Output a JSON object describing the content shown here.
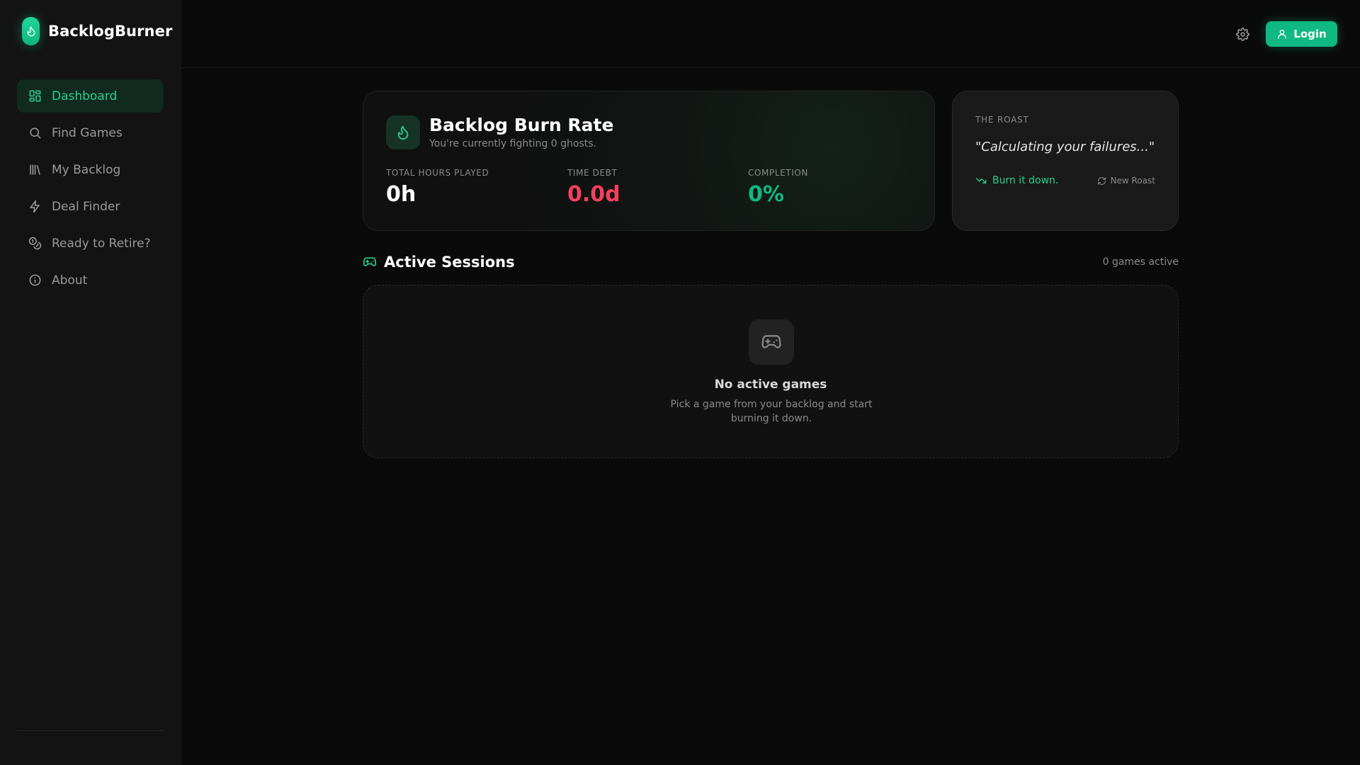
{
  "brand": {
    "name": "BacklogBurner",
    "accent": "#10b981"
  },
  "sidebar": {
    "items": [
      {
        "label": "Dashboard",
        "icon": "dashboard-grid-icon",
        "active": true
      },
      {
        "label": "Find Games",
        "icon": "search-icon"
      },
      {
        "label": "My Backlog",
        "icon": "library-icon"
      },
      {
        "label": "Deal Finder",
        "icon": "lightning-icon"
      },
      {
        "label": "Ready to Retire?",
        "icon": "coins-icon"
      },
      {
        "label": "About",
        "icon": "info-icon"
      }
    ]
  },
  "header": {
    "login_label": "Login",
    "settings_icon": "gear-icon"
  },
  "burn_rate": {
    "title": "Backlog Burn Rate",
    "subtitle": "You're currently fighting 0 ghosts.",
    "stats": [
      {
        "label": "TOTAL HOURS PLAYED",
        "value": "0h",
        "color": "#ffffff"
      },
      {
        "label": "TIME DEBT",
        "value": "0.0d",
        "color": "#f43f5e"
      },
      {
        "label": "COMPLETION",
        "value": "0%",
        "color": "#10b981"
      }
    ]
  },
  "roast": {
    "label": "THE ROAST",
    "quote": "\"Calculating your failures...\"",
    "burn_link": "Burn it down.",
    "new_roast": "New Roast"
  },
  "sessions": {
    "title": "Active Sessions",
    "count": "0 games active",
    "empty_title": "No active games",
    "empty_desc": "Pick a game from your backlog and start burning it down."
  }
}
